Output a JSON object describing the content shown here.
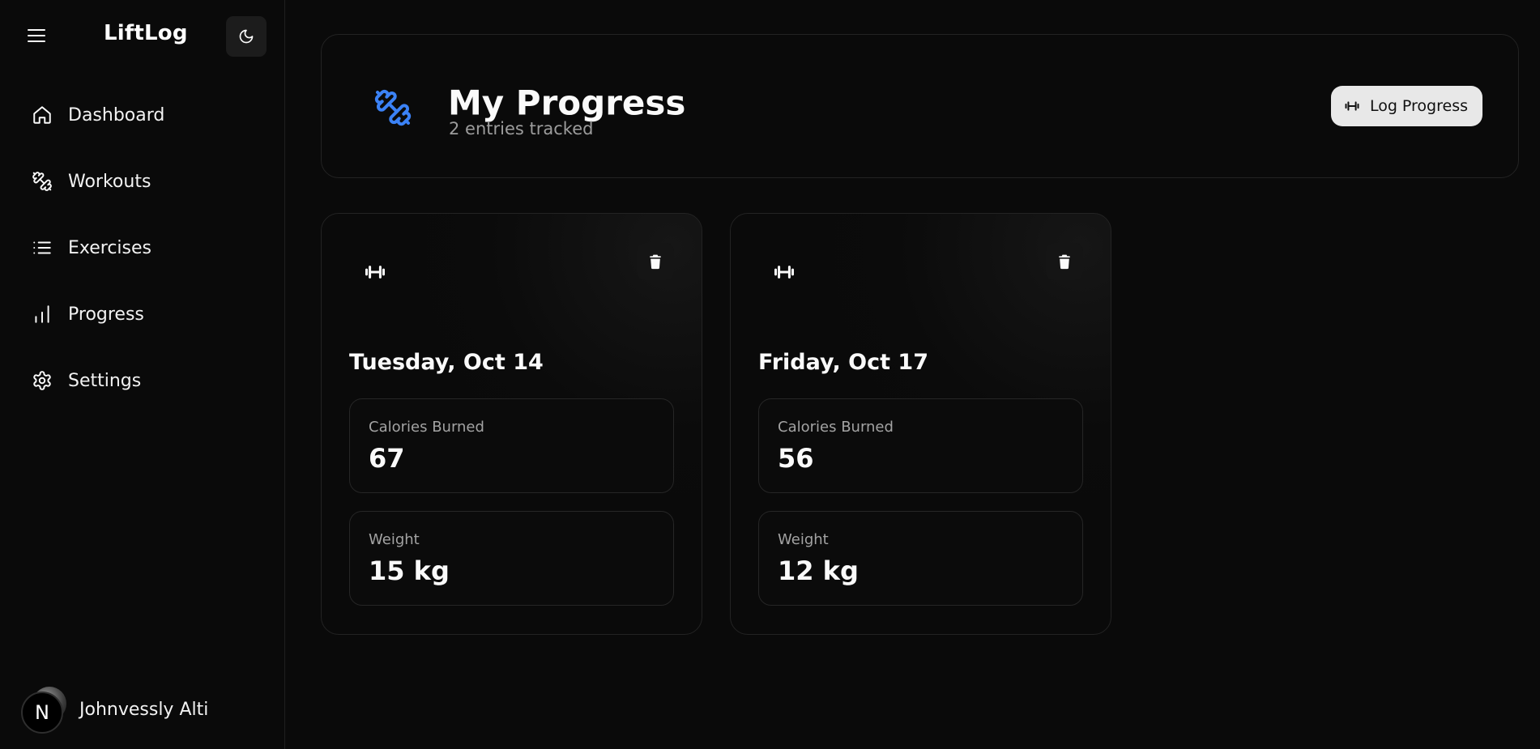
{
  "sidebar": {
    "brand": "LiftLog",
    "nav": [
      {
        "label": "Dashboard",
        "icon": "home-icon"
      },
      {
        "label": "Workouts",
        "icon": "dumbbell-icon"
      },
      {
        "label": "Exercises",
        "icon": "list-icon"
      },
      {
        "label": "Progress",
        "icon": "bar-chart-icon"
      },
      {
        "label": "Settings",
        "icon": "gear-icon"
      }
    ],
    "user": {
      "initial": "N",
      "name": "Johnvessly Alti"
    }
  },
  "header": {
    "title": "My Progress",
    "subtitle": "2 entries tracked",
    "log_button": "Log Progress",
    "accent_color": "#3b82f6"
  },
  "entries": [
    {
      "date": "Tuesday, Oct 14",
      "stats": [
        {
          "label": "Calories Burned",
          "value": "67"
        },
        {
          "label": "Weight",
          "value": "15 kg"
        }
      ]
    },
    {
      "date": "Friday, Oct 17",
      "stats": [
        {
          "label": "Calories Burned",
          "value": "56"
        },
        {
          "label": "Weight",
          "value": "12 kg"
        }
      ]
    }
  ]
}
